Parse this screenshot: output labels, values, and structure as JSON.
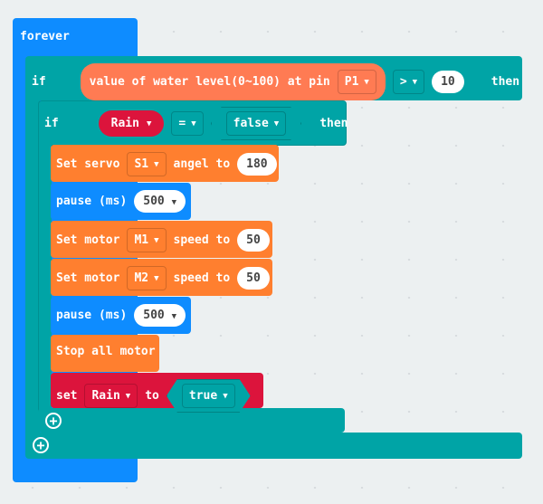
{
  "forever": {
    "label": "forever"
  },
  "outer_if": {
    "if": "if",
    "sensor": "value of water level(0~100) at pin",
    "pin": "P1",
    "op": ">",
    "value": "10",
    "then": "then"
  },
  "inner_if": {
    "if": "if",
    "var": "Rain",
    "op": "=",
    "value": "false",
    "then": "then"
  },
  "statements": {
    "servo": {
      "prefix": "Set servo",
      "servo": "S1",
      "mid": "angel to",
      "value": "180"
    },
    "pause1": {
      "label": "pause (ms)",
      "value": "500"
    },
    "motor1": {
      "prefix": "Set motor",
      "motor": "M1",
      "mid": "speed to",
      "value": "50"
    },
    "motor2": {
      "prefix": "Set motor",
      "motor": "M2",
      "mid": "speed to",
      "value": "50"
    },
    "pause2": {
      "label": "pause (ms)",
      "value": "500"
    },
    "stop": {
      "label": "Stop all motor"
    },
    "set": {
      "label": "set",
      "var": "Rain",
      "to": "to",
      "value": "true"
    }
  },
  "colors": {
    "loops": "#0e8cff",
    "logic": "#00a4a6",
    "motor": "#ff7f2f",
    "variables": "#dc143c"
  }
}
